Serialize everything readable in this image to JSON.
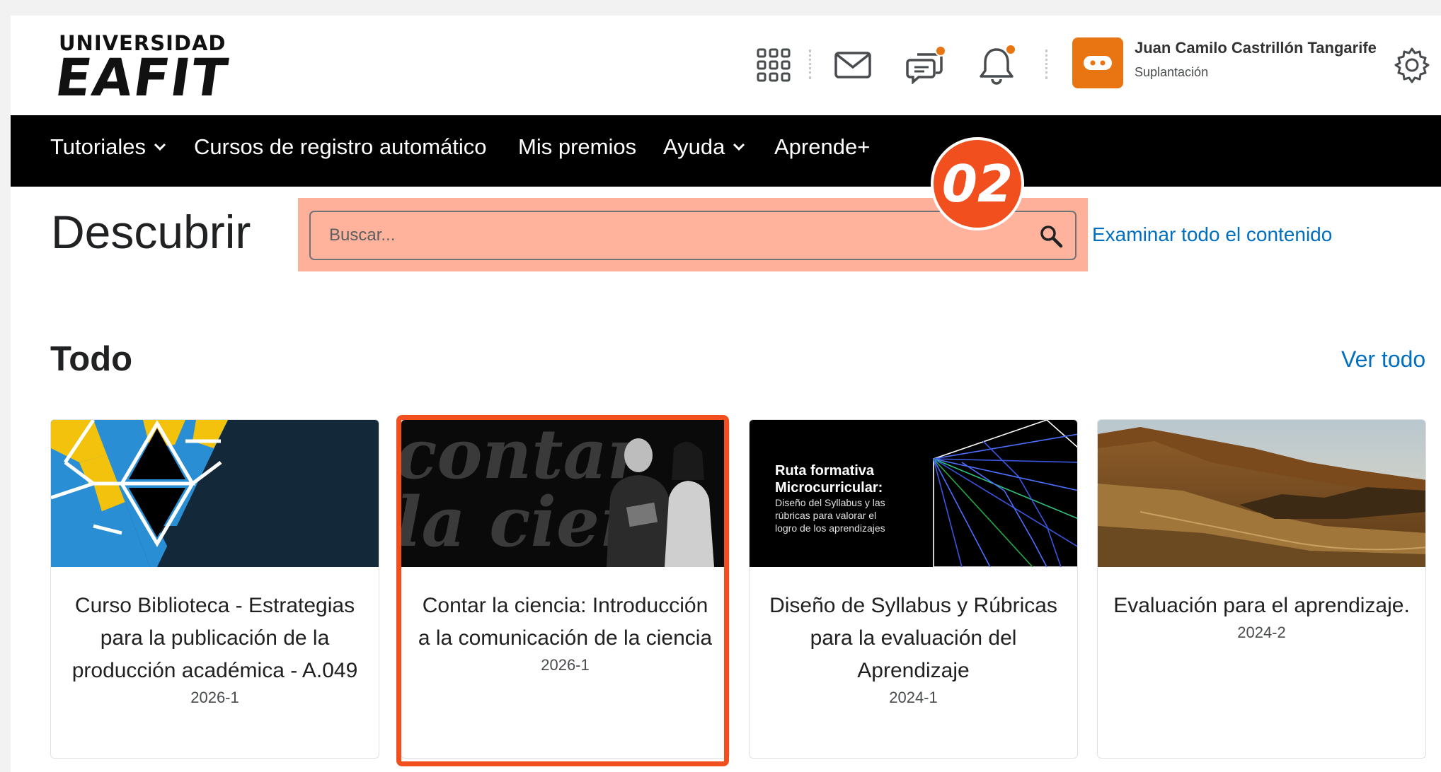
{
  "brand": {
    "line1": "UNIVERSIDAD",
    "line2": "EAFIT"
  },
  "header_icons": [
    "apps-grid-icon",
    "mail-icon",
    "chat-icon",
    "bell-icon",
    "settings-icon"
  ],
  "user": {
    "name": "Juan Camilo Castrillón Tangarife",
    "subtitle": "Suplantación",
    "accent": "#e87511"
  },
  "nav": {
    "items": [
      {
        "label": "Tutoriales",
        "dropdown": true
      },
      {
        "label": "Cursos de registro automático",
        "dropdown": false
      },
      {
        "label": "Mis premios",
        "dropdown": false
      },
      {
        "label": "Ayuda",
        "dropdown": true
      },
      {
        "label": "Aprende+",
        "dropdown": false
      }
    ]
  },
  "discover": {
    "title": "Descubrir",
    "search_placeholder": "Buscar...",
    "browse_link": "Examinar todo el contenido",
    "step_badge": "02"
  },
  "section": {
    "title": "Todo",
    "view_all": "Ver todo"
  },
  "cards": [
    {
      "title": "Curso Biblioteca - Estrategias para la publicación de la producción académica - A.049",
      "semester": "2026-1"
    },
    {
      "title": "Contar la ciencia: Introducción a la comunicación de la ciencia",
      "semester": "2026-1",
      "image_text": [
        "contar",
        "la cien"
      ],
      "highlighted": true
    },
    {
      "title": "Diseño de Syllabus y Rúbricas para la evaluación del Aprendizaje",
      "semester": "2024-1",
      "image_heading": "Ruta formativa Microcurricular:",
      "image_caption": "Diseño del Syllabus y las rúbricas para valorar el logro de los aprendizajes"
    },
    {
      "title": "Evaluación para el aprendizaje.",
      "semester": "2024-2"
    }
  ],
  "colors": {
    "highlight": "#f24f1e",
    "link": "#006fbf",
    "navbar": "#000000",
    "search_highlight": "#ffb09a"
  }
}
